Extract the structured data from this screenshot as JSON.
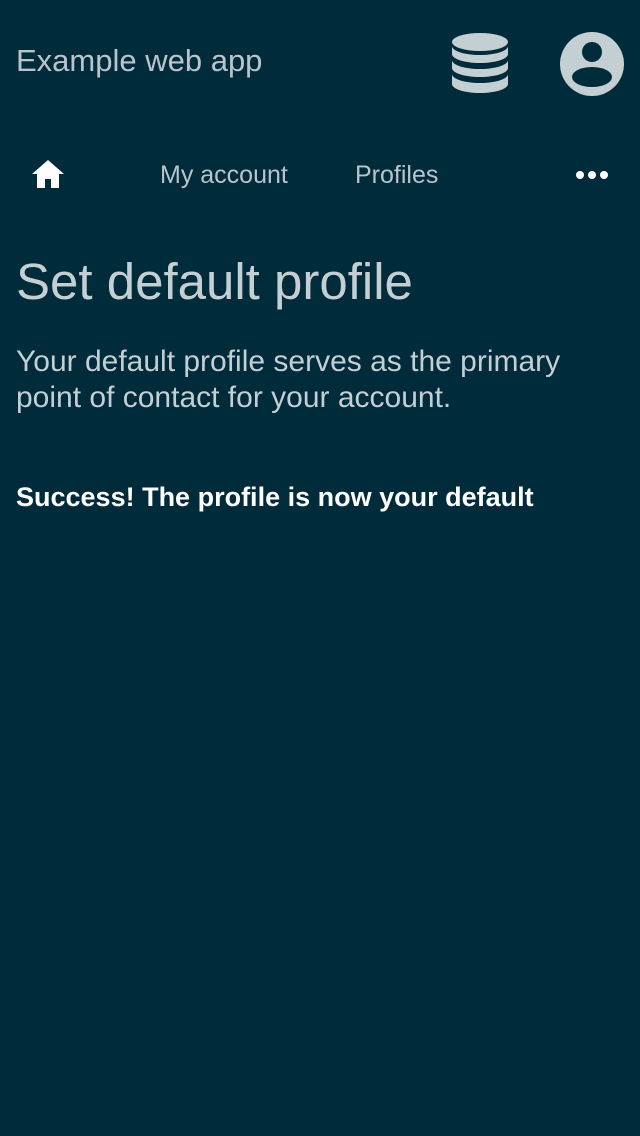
{
  "header": {
    "app_title": "Example web app",
    "icons": {
      "database": "database-icon",
      "account": "account-circle-icon"
    }
  },
  "nav": {
    "home_icon": "home-icon",
    "items": [
      {
        "label": "My account"
      },
      {
        "label": "Profiles"
      }
    ],
    "more_icon": "more-horizontal-icon"
  },
  "main": {
    "title": "Set default profile",
    "description": "Your default profile serves as the primary point of contact for your account.",
    "success_message": "Success! The profile is now your default"
  },
  "colors": {
    "background": "#002b3a",
    "text_muted": "#c4cfd3",
    "text_strong": "#ffffff"
  }
}
